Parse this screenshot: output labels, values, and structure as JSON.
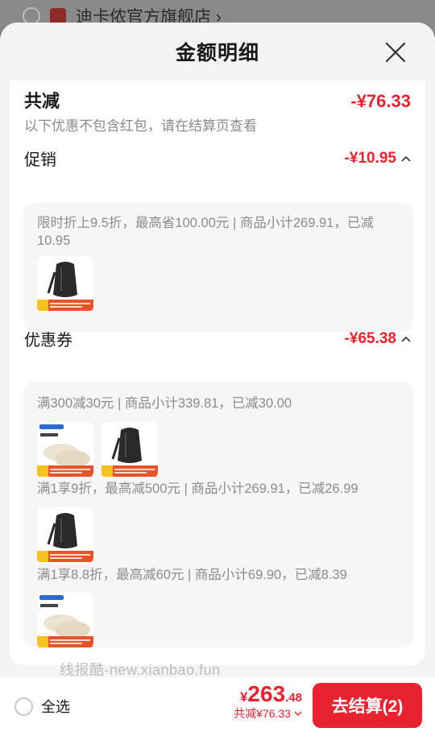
{
  "background": {
    "store_name": "迪卡侬官方旗舰店 ›"
  },
  "sheet": {
    "title": "金额明细",
    "total": {
      "label": "共减",
      "amount": "-¥76.33",
      "note": "以下优惠不包含红包，请在结算页查看"
    },
    "promotion": {
      "label": "促销",
      "amount": "-¥10.95",
      "rules": [
        {
          "text": "限时折上9.5折，最高省100.00元 | 商品小计269.91，已减10.95",
          "items": [
            "backpack"
          ]
        }
      ]
    },
    "coupon": {
      "label": "优惠券",
      "amount": "-¥65.38",
      "rules": [
        {
          "text": "满300减30元 | 商品小计339.81，已减30.00",
          "items": [
            "shoes",
            "backpack"
          ]
        },
        {
          "text": "满1享9折，最高减500元 | 商品小计269.91，已减26.99",
          "items": [
            "backpack"
          ]
        },
        {
          "text": "满1享8.8折，最高减60元 | 商品小计69.90，已减8.39",
          "items": [
            "shoes"
          ]
        }
      ]
    }
  },
  "watermark": "线报酷-new.xianbao.fun",
  "bottom_bar": {
    "select_all_label": "全选",
    "price_currency": "¥",
    "price_integer": "263",
    "price_decimal": ".48",
    "saved_text": "共减¥76.33",
    "checkout_label": "去结算(2)"
  },
  "colors": {
    "accent_red": "#e8232f",
    "muted_text": "#8c8c8c",
    "card_bg": "#f6f6f6"
  }
}
